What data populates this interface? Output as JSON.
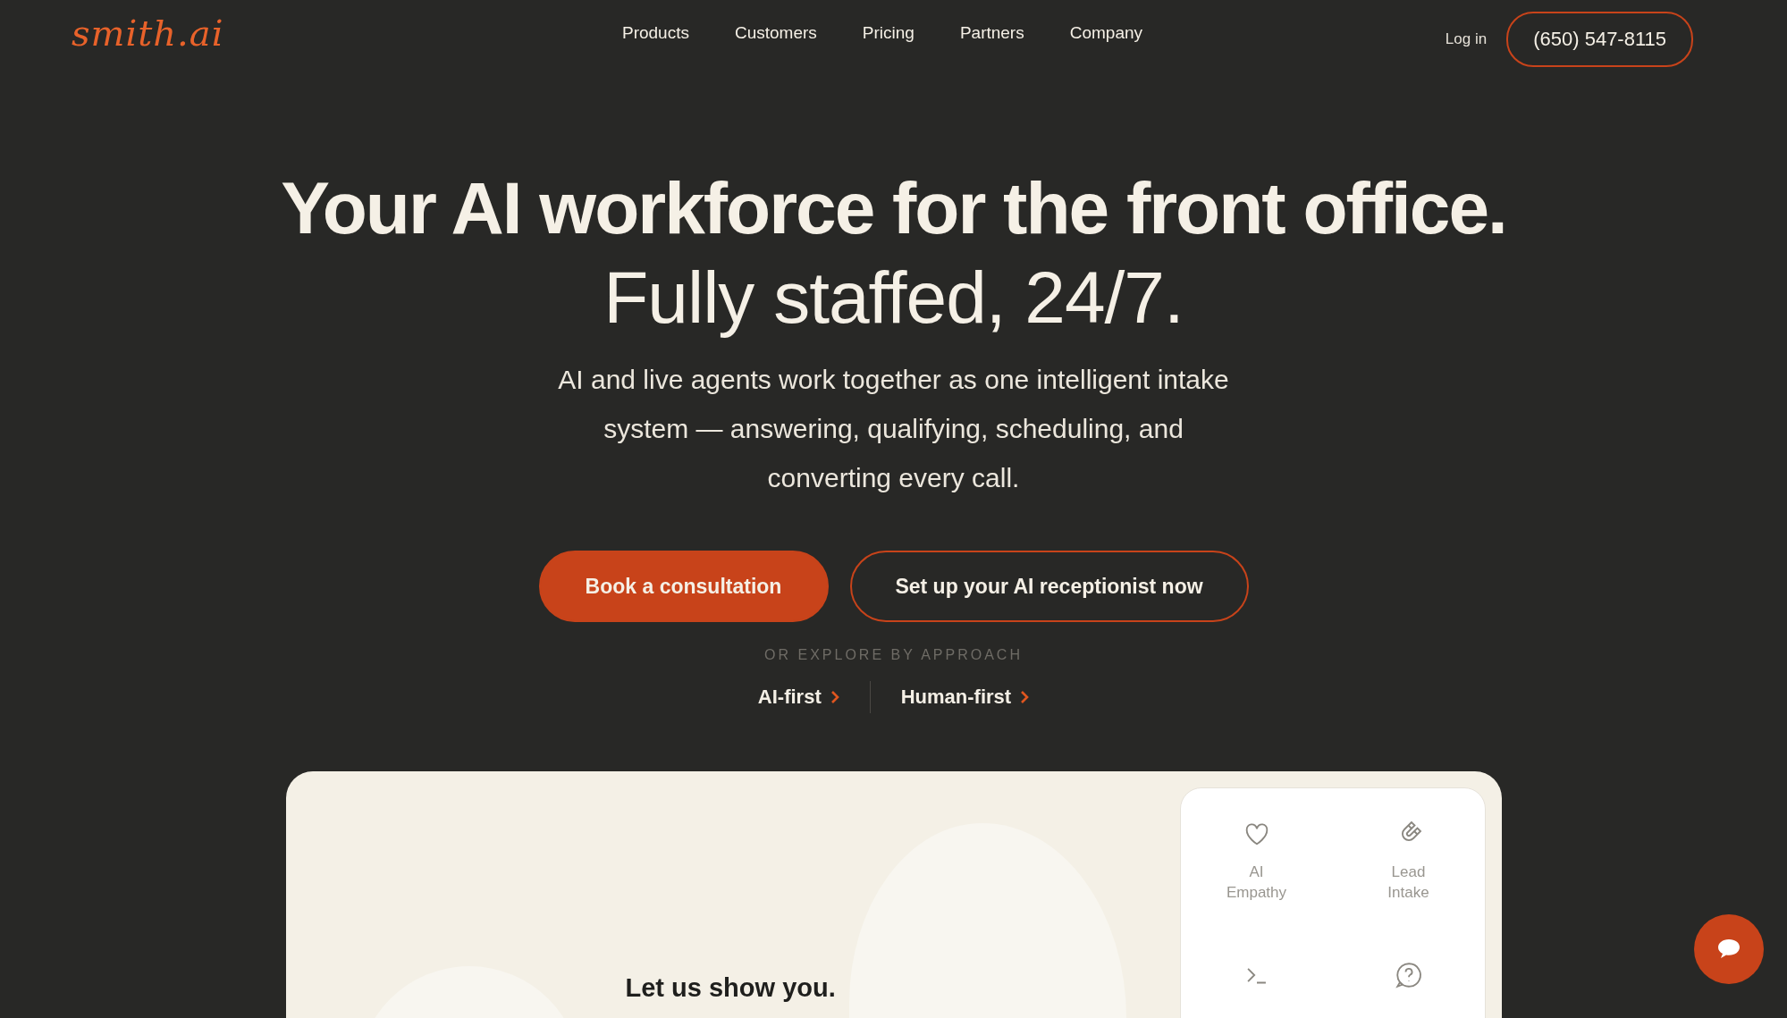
{
  "header": {
    "logo": "smith.ai",
    "nav": [
      {
        "label": "Products"
      },
      {
        "label": "Customers"
      },
      {
        "label": "Pricing"
      },
      {
        "label": "Partners"
      },
      {
        "label": "Company"
      }
    ],
    "login": "Log in",
    "phone": "(650) 547-8115"
  },
  "hero": {
    "title": "Your AI workforce for the front office.",
    "subtitle": "Fully staffed, 24/7.",
    "description": "AI and live agents work together as one intelligent intake system — answering, qualifying, scheduling, and converting every call.",
    "buttons": [
      {
        "label": "Book a consultation",
        "kind": "primary"
      },
      {
        "label": "Set up your AI receptionist now",
        "kind": "outline"
      }
    ],
    "explore_label": "OR EXPLORE BY APPROACH",
    "approaches": [
      {
        "label": "AI-first"
      },
      {
        "label": "Human-first"
      }
    ]
  },
  "preview": {
    "heading": "Let us show you.",
    "features": [
      {
        "kind": "heart",
        "label": "AI Empathy"
      },
      {
        "kind": "magnet",
        "label": "Lead Intake"
      },
      {
        "kind": "terminal"
      },
      {
        "kind": "question"
      }
    ]
  }
}
